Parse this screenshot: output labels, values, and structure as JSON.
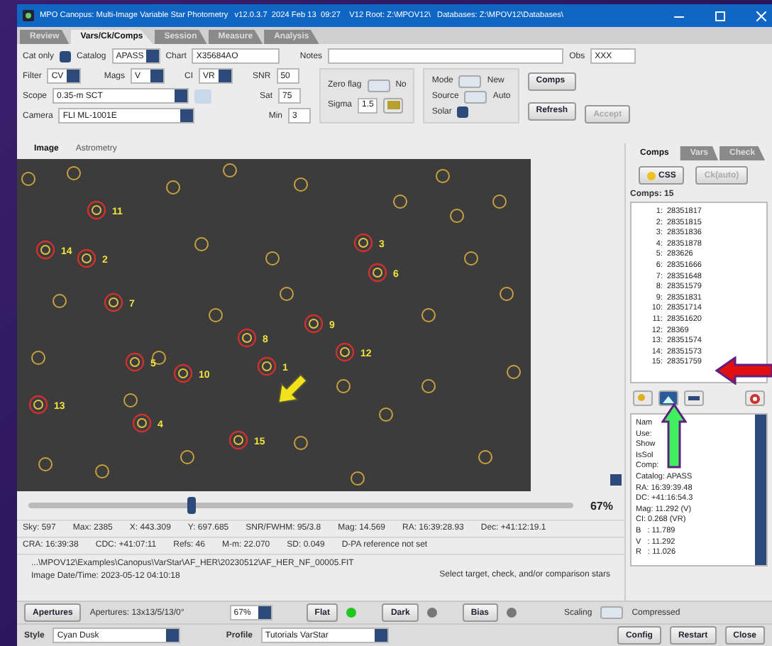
{
  "window": {
    "title": "MPO Canopus: Multi-Image Variable Star Photometry   v12.0.3.7  2024 Feb 13  09:27    V12 Root: Z:\\MPOV12\\   Databases: Z:\\MPOV12\\Databases\\"
  },
  "tabs": [
    {
      "label": "Review",
      "selected": false
    },
    {
      "label": "Vars/Ck/Comps",
      "selected": true
    },
    {
      "label": "Session",
      "selected": false
    },
    {
      "label": "Measure",
      "selected": false
    },
    {
      "label": "Analysis",
      "selected": false
    }
  ],
  "setup": {
    "cat_only": {
      "label": "Cat only",
      "checked": true
    },
    "catalog": {
      "label": "Catalog",
      "value": "APASS"
    },
    "chart": {
      "label": "Chart",
      "value": "X35684AO"
    },
    "notes": {
      "label": "Notes"
    },
    "obs": {
      "label": "Obs",
      "value": "XXX"
    },
    "filter": {
      "label": "Filter",
      "value": "CV"
    },
    "mags": {
      "label": "Mags",
      "value": "V"
    },
    "ci": {
      "label": "CI",
      "value": "VR"
    },
    "snr": {
      "label": "SNR",
      "value": "50"
    },
    "scope": {
      "label": "Scope",
      "value": "0.35-m SCT"
    },
    "sat": {
      "label": "Sat",
      "value": "75"
    },
    "camera": {
      "label": "Camera",
      "value": "FLI ML-1001E"
    },
    "min": {
      "label": "Min",
      "value": "3"
    },
    "zero_flag": {
      "label": "Zero flag",
      "on": false,
      "state": "No"
    },
    "sigma": {
      "label": "Sigma",
      "value": "1.5"
    },
    "mode": {
      "label": "Mode",
      "on": false,
      "state": "New"
    },
    "source": {
      "label": "Source",
      "on": false,
      "state": "Auto"
    },
    "solar": {
      "label": "Solar",
      "checked": true
    },
    "comps_button": "Comps",
    "refresh_button": "Refresh",
    "accept_button": {
      "label": "Accept",
      "disabled": true
    }
  },
  "image_tabs": [
    {
      "label": "Image",
      "selected": true
    },
    {
      "label": "Astrometry",
      "selected": false
    }
  ],
  "markers": [
    "11",
    "14",
    "2",
    "3",
    "6",
    "7",
    "9",
    "8",
    "12",
    "1",
    "10",
    "5",
    "13",
    "4",
    "15"
  ],
  "zoom": {
    "level": 0.3,
    "reading": "67%"
  },
  "status_rows": [
    [
      "Sky: 597",
      "Max: 2385",
      "X: 443.309",
      "Y: 697.685",
      "SNR/FWHM: 95/3.8",
      "Mag: 14.569",
      "RA: 16:39:28.93",
      "Dec: +41:12:19.1"
    ],
    [
      "CRA: 16:39:38",
      "CDC: +41:07:11",
      "Refs: 46",
      "M-m: 22.070",
      "SD: 0.049",
      "D-PA reference not set"
    ]
  ],
  "file_path": "...\\MPOV12\\Examples\\Canopus\\VarStar\\AF_HER\\20230512\\AF_HER_NF_00005.FIT",
  "image_date": "Image Date/Time: 2023-05-12  04:10:18",
  "hint": "Select target, check, and/or comparison stars",
  "bottom": {
    "apertures_button": "Apertures",
    "apertures": "Apertures: 13x13/5/13/0°",
    "zoom": "67%",
    "calibration": [
      {
        "label": "Flat",
        "on": true
      },
      {
        "label": "Dark",
        "on": false
      },
      {
        "label": "Bias",
        "on": false
      }
    ],
    "scaling": {
      "label": "Scaling",
      "on": false,
      "state": "Compressed"
    }
  },
  "footer": {
    "style": {
      "label": "Style",
      "value": "Cyan Dusk"
    },
    "profile": {
      "label": "Profile",
      "value": "Tutorials VarStar"
    },
    "buttons": [
      "Config",
      "Restart",
      "Close"
    ]
  },
  "side": {
    "tabs": [
      {
        "label": "Comps",
        "selected": true
      },
      {
        "label": "Vars",
        "selected": false
      },
      {
        "label": "Check",
        "selected": false
      }
    ],
    "css_button": "CSS",
    "auto_button": {
      "label": "Ck(auto)",
      "disabled": true
    },
    "count": "Comps: 15",
    "comps": [
      {
        "n": "1:",
        "id": "28351817"
      },
      {
        "n": "2:",
        "id": "28351815"
      },
      {
        "n": "3:",
        "id": "28351836"
      },
      {
        "n": "4:",
        "id": "28351878"
      },
      {
        "n": "5:",
        "id": "283626"
      },
      {
        "n": "6:",
        "id": "28351666"
      },
      {
        "n": "7:",
        "id": "28351648"
      },
      {
        "n": "8:",
        "id": "28351579"
      },
      {
        "n": "9:",
        "id": "28351831"
      },
      {
        "n": "10:",
        "id": "28351714"
      },
      {
        "n": "11:",
        "id": "28351620"
      },
      {
        "n": "12:",
        "id": "28369"
      },
      {
        "n": "13:",
        "id": "28351574"
      },
      {
        "n": "14:",
        "id": "28351573"
      },
      {
        "n": "15:",
        "id": "28351759"
      }
    ],
    "info": [
      "Nam",
      "Use:",
      "Show",
      "IsSol",
      "Comp:",
      "Catalog: APASS",
      "RA: 16:39:39.48",
      "DC: +41:16:54.3",
      "Mag: 11.292 (V)",
      "CI: 0.268 (VR)",
      "B   : 11.789",
      "V   : 11.292",
      "R   : 11.026"
    ]
  }
}
